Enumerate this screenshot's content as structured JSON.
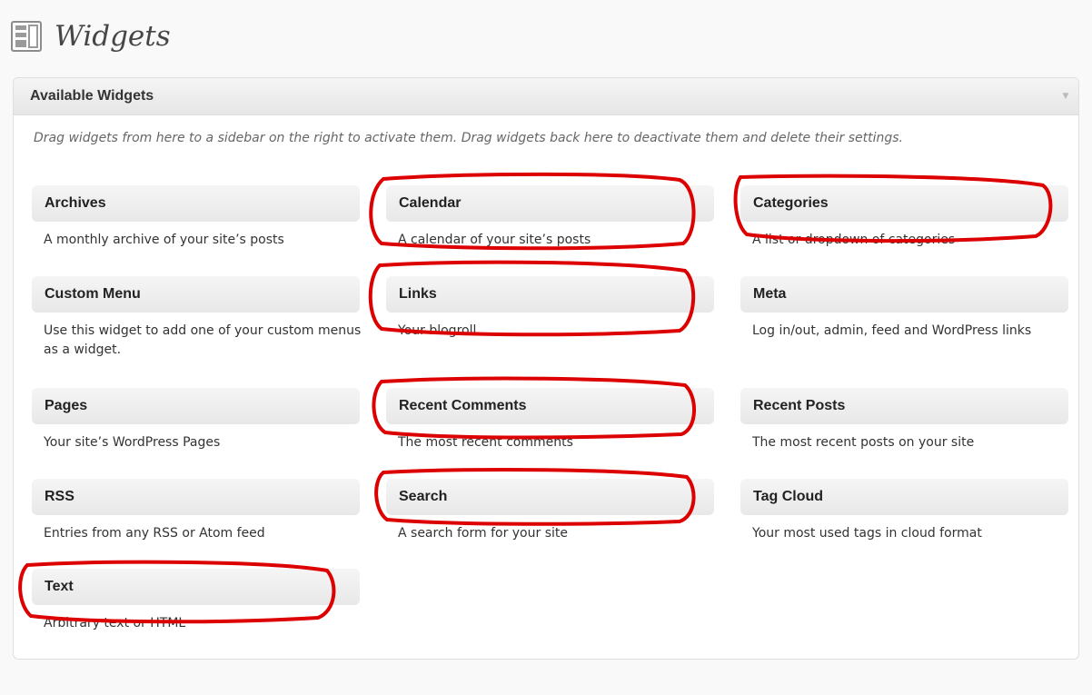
{
  "page": {
    "title": "Widgets",
    "icon": "widgets-icon"
  },
  "panel": {
    "title": "Available Widgets",
    "toggle_glyph": "▼",
    "description": "Drag widgets from here to a sidebar on the right to activate them. Drag widgets back here to deactivate them and delete their settings."
  },
  "widgets": [
    {
      "title": "Archives",
      "description": "A monthly archive of your site’s posts"
    },
    {
      "title": "Calendar",
      "description": "A calendar of your site’s posts"
    },
    {
      "title": "Categories",
      "description": "A list or dropdown of categories"
    },
    {
      "title": "Custom Menu",
      "description": "Use this widget to add one of your custom menus as a widget."
    },
    {
      "title": "Links",
      "description": "Your blogroll"
    },
    {
      "title": "Meta",
      "description": "Log in/out, admin, feed and WordPress links"
    },
    {
      "title": "Pages",
      "description": "Your site’s WordPress Pages"
    },
    {
      "title": "Recent Comments",
      "description": "The most recent comments"
    },
    {
      "title": "Recent Posts",
      "description": "The most recent posts on your site"
    },
    {
      "title": "RSS",
      "description": "Entries from any RSS or Atom feed"
    },
    {
      "title": "Search",
      "description": "A search form for your site"
    },
    {
      "title": "Tag Cloud",
      "description": "Your most used tags in cloud format"
    },
    {
      "title": "Text",
      "description": "Arbitrary text or HTML"
    }
  ],
  "colors": {
    "highlight_ring": "#dd0000",
    "panel_header": "#e6e6e6",
    "title_text": "#464646"
  }
}
